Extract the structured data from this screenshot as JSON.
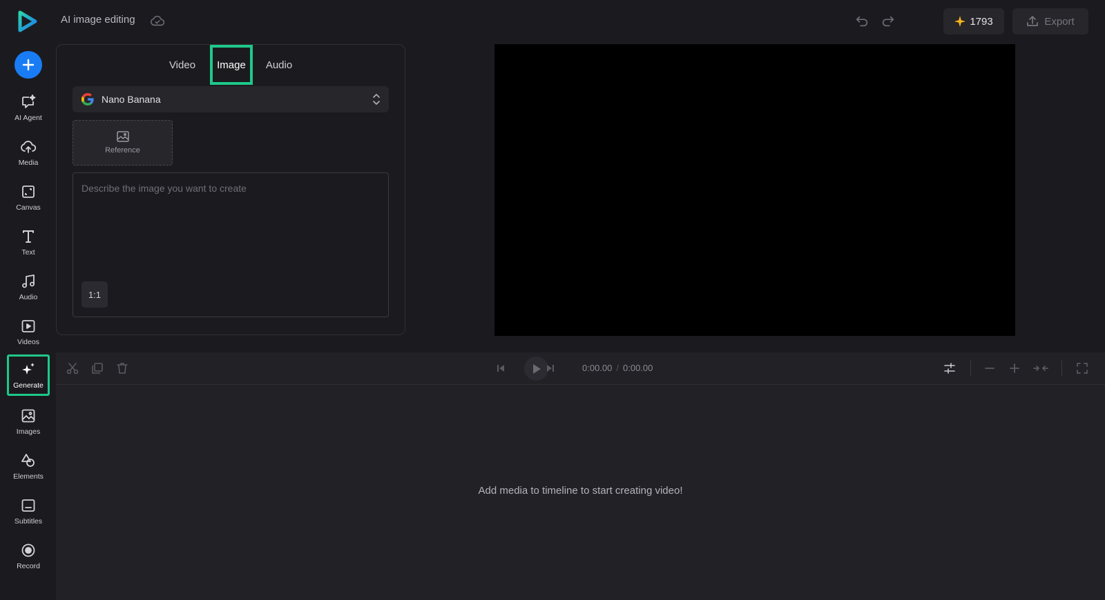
{
  "app": {
    "title": "AI image editing",
    "credits": "1793",
    "export_label": "Export",
    "accent_color": "#1ec98a",
    "brand_color": "#1a7cf5"
  },
  "sidebar": {
    "items": [
      {
        "label": "AI Agent",
        "icon": "ai-agent-icon"
      },
      {
        "label": "Media",
        "icon": "upload-cloud-icon"
      },
      {
        "label": "Canvas",
        "icon": "canvas-icon"
      },
      {
        "label": "Text",
        "icon": "text-icon"
      },
      {
        "label": "Audio",
        "icon": "music-icon"
      },
      {
        "label": "Videos",
        "icon": "video-icon"
      },
      {
        "label": "Generate",
        "icon": "sparkle-icon",
        "active": true
      },
      {
        "label": "Images",
        "icon": "image-icon"
      },
      {
        "label": "Elements",
        "icon": "shapes-icon"
      },
      {
        "label": "Subtitles",
        "icon": "subtitles-icon"
      },
      {
        "label": "Record",
        "icon": "record-icon"
      }
    ]
  },
  "generate": {
    "tabs": [
      "Video",
      "Image",
      "Audio"
    ],
    "active_tab": "Image",
    "model": "Nano Banana",
    "reference_label": "Reference",
    "prompt_placeholder": "Describe the image you want to create",
    "prompt_value": "",
    "aspect_ratio": "1:1"
  },
  "timeline": {
    "current_time": "0:00.00",
    "total_time": "0:00.00",
    "time_separator": "/",
    "empty_message": "Add media to timeline to start creating video!"
  }
}
